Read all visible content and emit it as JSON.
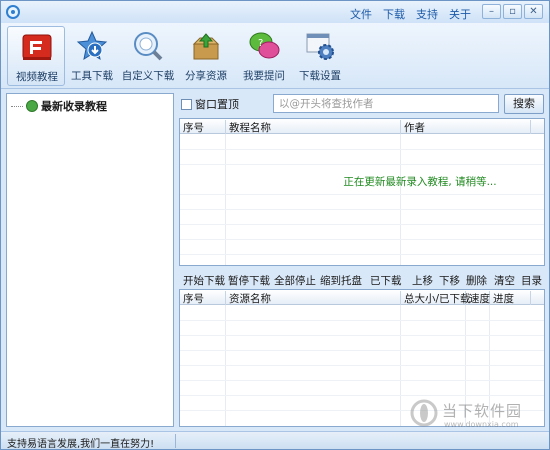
{
  "menu": [
    "文件",
    "下载",
    "支持",
    "关于"
  ],
  "window_controls": [
    "minimize",
    "restore",
    "close"
  ],
  "toolbar": [
    {
      "label": "视频教程",
      "icon": "video-tutorial-icon",
      "active": true
    },
    {
      "label": "工具下载",
      "icon": "star-download-icon",
      "active": false
    },
    {
      "label": "自定义下载",
      "icon": "custom-download-icon",
      "active": false
    },
    {
      "label": "分享资源",
      "icon": "share-box-icon",
      "active": false
    },
    {
      "label": "我要提问",
      "icon": "chat-bubbles-icon",
      "active": false
    },
    {
      "label": "下载设置",
      "icon": "settings-gears-icon",
      "active": false
    }
  ],
  "tree": {
    "root_label": "最新收录教程"
  },
  "options": {
    "always_on_top_label": "窗口置顶",
    "always_on_top_checked": false
  },
  "search": {
    "placeholder": "以@开头将查找作者",
    "value": "",
    "button": "搜索"
  },
  "tutorial_table": {
    "columns": [
      "序号",
      "教程名称",
      "作者"
    ],
    "message": "正在更新最新录入教程, 请稍等..."
  },
  "actions": {
    "left": [
      "开始下载",
      "暂停下载",
      "全部停止",
      "缩到托盘",
      "已下载"
    ],
    "right": [
      "上移",
      "下移",
      "删除",
      "清空",
      "目录"
    ]
  },
  "resource_table": {
    "columns": [
      "序号",
      "资源名称",
      "总大小/已下载",
      "速度",
      "进度"
    ]
  },
  "status": {
    "text": "支持易语言发展,我们一直在努力!"
  },
  "watermark": {
    "name": "当下软件园",
    "url": "www.downxia.com"
  },
  "colors": {
    "accent": "#1d5aa8",
    "status_green": "#1f8a1f",
    "panel_bg": "#d9e8f8"
  }
}
